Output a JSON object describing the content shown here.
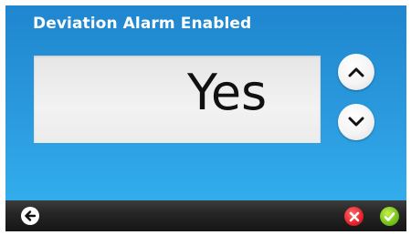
{
  "header": {
    "title": "Deviation Alarm Enabled"
  },
  "value_display": {
    "value": "Yes"
  },
  "controls": {
    "increase_icon": "chevron-up-icon",
    "decrease_icon": "chevron-down-icon"
  },
  "footer": {
    "back_icon": "arrow-left-icon",
    "cancel_icon": "close-icon",
    "confirm_icon": "checkmark-icon"
  },
  "colors": {
    "screen_background": "#2a98dc",
    "value_box_background": "#efefef",
    "footer_background": "#262626",
    "cancel": "#e8232b",
    "confirm": "#74c01c"
  }
}
